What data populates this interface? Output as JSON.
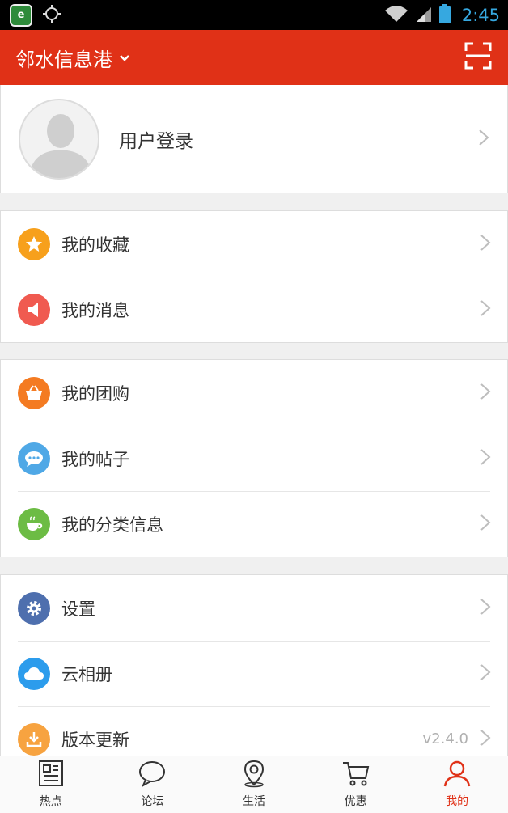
{
  "status_bar": {
    "badge_letter": "e",
    "time": "2:45"
  },
  "header": {
    "title": "邻水信息港",
    "accent": "#e03117"
  },
  "profile": {
    "login_label": "用户登录"
  },
  "groups": [
    {
      "rows": [
        {
          "label": "我的收藏",
          "icon": "star-icon",
          "color": "#f7a01c"
        },
        {
          "label": "我的消息",
          "icon": "megaphone-icon",
          "color": "#f05a50"
        }
      ]
    },
    {
      "rows": [
        {
          "label": "我的团购",
          "icon": "basket-icon",
          "color": "#f47b22"
        },
        {
          "label": "我的帖子",
          "icon": "chat-bubble-icon",
          "color": "#4fa8e6"
        },
        {
          "label": "我的分类信息",
          "icon": "cup-icon",
          "color": "#6cbc44"
        }
      ]
    },
    {
      "rows": [
        {
          "label": "设置",
          "icon": "gear-icon",
          "color": "#4e6fae"
        },
        {
          "label": "云相册",
          "icon": "cloud-icon",
          "color": "#2c9cec"
        },
        {
          "label": "版本更新",
          "icon": "download-icon",
          "color": "#f7a340",
          "version": "v2.4.0"
        }
      ]
    }
  ],
  "bottom_nav": [
    {
      "label": "热点",
      "icon": "newspaper-icon"
    },
    {
      "label": "论坛",
      "icon": "forum-bubble-icon"
    },
    {
      "label": "生活",
      "icon": "map-pin-icon"
    },
    {
      "label": "优惠",
      "icon": "cart-icon"
    },
    {
      "label": "我的",
      "icon": "person-icon",
      "active": true
    }
  ]
}
